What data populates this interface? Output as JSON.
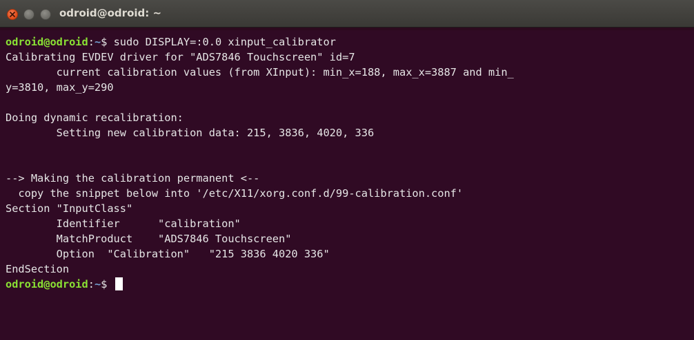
{
  "window": {
    "title": "odroid@odroid: ~"
  },
  "colors": {
    "background": "#300a24",
    "prompt_user": "#8ae234",
    "prompt_path": "#729fcf",
    "text": "#e6e6e6",
    "close_button": "#df4a16"
  },
  "icons": {
    "close": "close-icon",
    "minimize": "minimize-icon",
    "maximize": "maximize-icon"
  },
  "terminal": {
    "prompt_user": "odroid@odroid",
    "prompt_colon": ":",
    "prompt_path": "~",
    "prompt_dollar": "$",
    "command": " sudo DISPLAY=:0.0 xinput_calibrator",
    "lines": [
      "Calibrating EVDEV driver for \"ADS7846 Touchscreen\" id=7",
      "        current calibration values (from XInput): min_x=188, max_x=3887 and min_",
      "y=3810, max_y=290",
      "",
      "Doing dynamic recalibration:",
      "        Setting new calibration data: 215, 3836, 4020, 336",
      "",
      "",
      "--> Making the calibration permanent <--",
      "  copy the snippet below into '/etc/X11/xorg.conf.d/99-calibration.conf'",
      "Section \"InputClass\"",
      "        Identifier      \"calibration\"",
      "        MatchProduct    \"ADS7846 Touchscreen\"",
      "        Option  \"Calibration\"   \"215 3836 4020 336\"",
      "EndSection"
    ]
  }
}
